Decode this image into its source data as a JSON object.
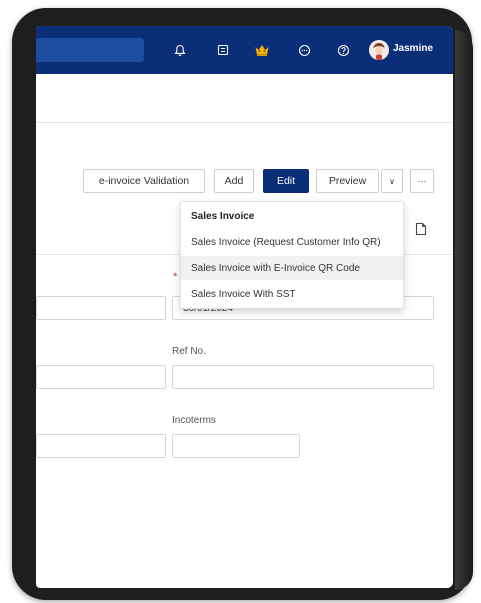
{
  "topbar": {
    "user_name": "Jasmine",
    "icons": [
      "bell-icon",
      "list-icon",
      "crown-icon",
      "chat-icon",
      "help-icon"
    ]
  },
  "toolbar": {
    "einvoice_validation_label": "e-invoice Validation",
    "add_label": "Add",
    "edit_label": "Edit",
    "preview_label": "Preview",
    "caret_label": "∨",
    "more_label": "···"
  },
  "print_menu": {
    "items": [
      {
        "label": "Sales Invoice"
      },
      {
        "label": "Sales Invoice (Request Customer Info QR)"
      },
      {
        "label": "Sales Invoice with E-Invoice QR Code"
      },
      {
        "label": "Sales Invoice With SST"
      }
    ]
  },
  "form": {
    "required_mark": "*",
    "date_value": "30/01/2024",
    "ref_no_label": "Ref No.",
    "incoterms_label": "Incoterms"
  },
  "colors": {
    "accent": "#0b2e78",
    "required": "#d9342b"
  }
}
